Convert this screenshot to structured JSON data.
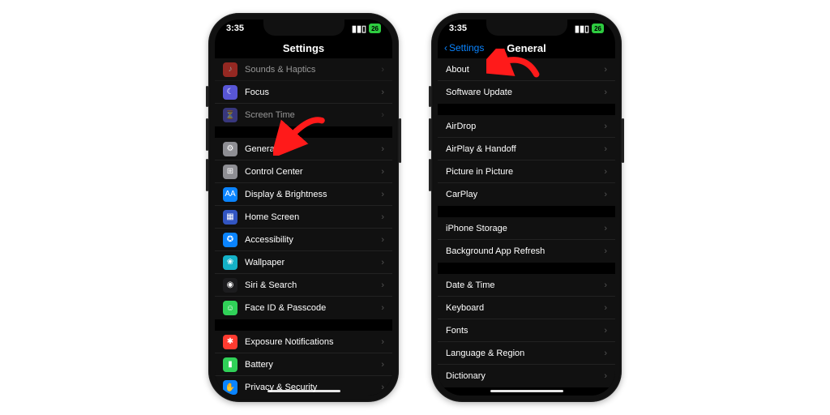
{
  "status": {
    "time": "3:35",
    "battery": "26"
  },
  "phone1": {
    "title": "Settings",
    "arrow_target": "general",
    "groups": [
      {
        "first": true,
        "rows": [
          {
            "id": "sounds",
            "label": "Sounds & Haptics",
            "icon_bg": "#ff3b30",
            "glyph": "♪",
            "dim": true
          },
          {
            "id": "focus",
            "label": "Focus",
            "icon_bg": "#5856d6",
            "glyph": "☾"
          },
          {
            "id": "screentime",
            "label": "Screen Time",
            "icon_bg": "#5856d6",
            "glyph": "⏳",
            "dim": true
          }
        ]
      },
      {
        "rows": [
          {
            "id": "general",
            "label": "General",
            "icon_bg": "#8e8e93",
            "glyph": "⚙"
          },
          {
            "id": "control",
            "label": "Control Center",
            "icon_bg": "#8e8e93",
            "glyph": "⊞"
          },
          {
            "id": "display",
            "label": "Display & Brightness",
            "icon_bg": "#0a84ff",
            "glyph": "AA"
          },
          {
            "id": "home",
            "label": "Home Screen",
            "icon_bg": "#3255c2",
            "glyph": "▦"
          },
          {
            "id": "access",
            "label": "Accessibility",
            "icon_bg": "#0a84ff",
            "glyph": "✪"
          },
          {
            "id": "wall",
            "label": "Wallpaper",
            "icon_bg": "#14b1c7",
            "glyph": "❀"
          },
          {
            "id": "siri",
            "label": "Siri & Search",
            "icon_bg": "#1c1c1e",
            "glyph": "◉"
          },
          {
            "id": "faceid",
            "label": "Face ID & Passcode",
            "icon_bg": "#30d158",
            "glyph": "☺"
          }
        ]
      },
      {
        "rows": [
          {
            "id": "exposure",
            "label": "Exposure Notifications",
            "icon_bg": "#ff3b30",
            "glyph": "✱"
          },
          {
            "id": "battery",
            "label": "Battery",
            "icon_bg": "#30d158",
            "glyph": "▮"
          },
          {
            "id": "privacy",
            "label": "Privacy & Security",
            "icon_bg": "#0a84ff",
            "glyph": "✋"
          }
        ]
      }
    ]
  },
  "phone2": {
    "title": "General",
    "back": "Settings",
    "arrow_target": "about",
    "groups": [
      {
        "first": true,
        "rows": [
          {
            "id": "about",
            "label": "About"
          },
          {
            "id": "swupdate",
            "label": "Software Update"
          }
        ]
      },
      {
        "rows": [
          {
            "id": "airdrop",
            "label": "AirDrop"
          },
          {
            "id": "airplay",
            "label": "AirPlay & Handoff"
          },
          {
            "id": "pip",
            "label": "Picture in Picture"
          },
          {
            "id": "carplay",
            "label": "CarPlay"
          }
        ]
      },
      {
        "rows": [
          {
            "id": "storage",
            "label": "iPhone Storage"
          },
          {
            "id": "bgapp",
            "label": "Background App Refresh"
          }
        ]
      },
      {
        "rows": [
          {
            "id": "datetime",
            "label": "Date & Time"
          },
          {
            "id": "keyboard",
            "label": "Keyboard"
          },
          {
            "id": "fonts",
            "label": "Fonts"
          },
          {
            "id": "lang",
            "label": "Language & Region"
          },
          {
            "id": "dict",
            "label": "Dictionary"
          }
        ]
      }
    ]
  }
}
